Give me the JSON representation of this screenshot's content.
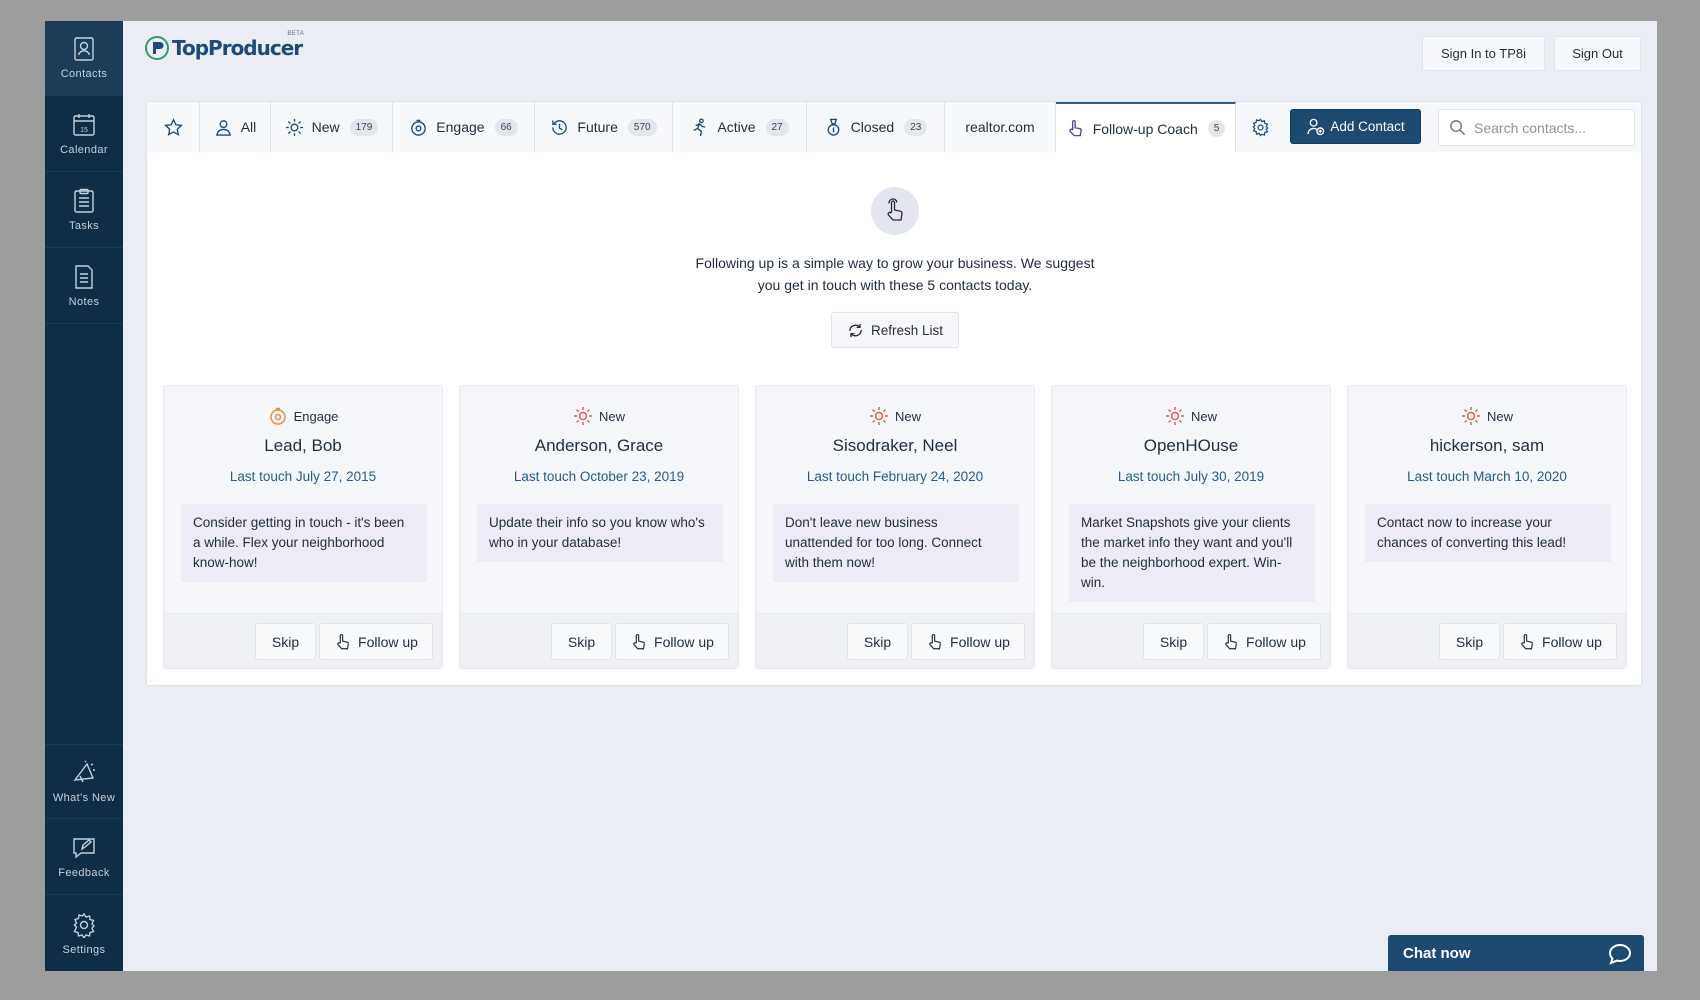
{
  "sidebar": {
    "top": [
      {
        "label": "Contacts",
        "icon": "contacts-icon"
      },
      {
        "label": "Calendar",
        "icon": "calendar-icon",
        "day": "15"
      },
      {
        "label": "Tasks",
        "icon": "tasks-icon"
      },
      {
        "label": "Notes",
        "icon": "notes-icon"
      }
    ],
    "bottom": [
      {
        "label": "What's New",
        "icon": "megaphone-icon"
      },
      {
        "label": "Feedback",
        "icon": "feedback-icon"
      },
      {
        "label": "Settings",
        "icon": "gear-icon"
      }
    ]
  },
  "header": {
    "logo_text": "TopProducer",
    "logo_badge": "BETA",
    "sign_in_label": "Sign In to TP8i",
    "sign_out_label": "Sign Out"
  },
  "tabs": [
    {
      "label": "",
      "icon": "star-icon"
    },
    {
      "label": "All",
      "icon": "person-icon"
    },
    {
      "label": "New",
      "count": "179",
      "icon": "sun-icon"
    },
    {
      "label": "Engage",
      "count": "66",
      "icon": "engage-icon"
    },
    {
      "label": "Future",
      "count": "570",
      "icon": "history-icon"
    },
    {
      "label": "Active",
      "count": "27",
      "icon": "running-icon"
    },
    {
      "label": "Closed",
      "count": "23",
      "icon": "medal-icon"
    },
    {
      "label": "realtor.com"
    },
    {
      "label": "Follow-up Coach",
      "count": "5",
      "icon": "pointer-hand-icon",
      "active": true
    }
  ],
  "toolbar": {
    "add_contact_label": "Add Contact",
    "search_placeholder": "Search contacts..."
  },
  "coach": {
    "intro": "Following up is a simple way to grow your business. We suggest you get in touch with these 5 contacts today.",
    "refresh_label": "Refresh List",
    "skip_label": "Skip",
    "follow_label": "Follow up"
  },
  "cards": [
    {
      "status": "Engage",
      "status_icon": "engage-icon",
      "name": "Lead, Bob",
      "last_touch": "Last touch July 27, 2015",
      "message": "Consider getting in touch - it's been a while. Flex your neighborhood know-how!"
    },
    {
      "status": "New",
      "status_icon": "sun-icon",
      "name": "Anderson, Grace",
      "last_touch": "Last touch October 23, 2019",
      "message": "Update their info so you know who's who in your database!"
    },
    {
      "status": "New",
      "status_icon": "sun-icon",
      "name": "Sisodraker, Neel",
      "last_touch": "Last touch February 24, 2020",
      "message": "Don't leave new business unattended for too long. Connect with them now!"
    },
    {
      "status": "New",
      "status_icon": "sun-icon",
      "name": "OpenHOuse",
      "last_touch": "Last touch July 30, 2019",
      "message": "Market Snapshots give your clients the market info they want and you'll be the neighborhood expert. Win-win."
    },
    {
      "status": "New",
      "status_icon": "sun-icon",
      "name": "hickerson, sam",
      "last_touch": "Last touch March 10, 2020",
      "message": "Contact now to increase your chances of converting this lead!"
    }
  ],
  "chat": {
    "label": "Chat now",
    "icon": "chat-bubble-icon"
  },
  "colors": {
    "sidebar": "#0f2d44",
    "primary": "#1c4a70",
    "link": "#245a8f",
    "new_icon": "#e2584a",
    "engage_icon": "#e58a2e"
  }
}
